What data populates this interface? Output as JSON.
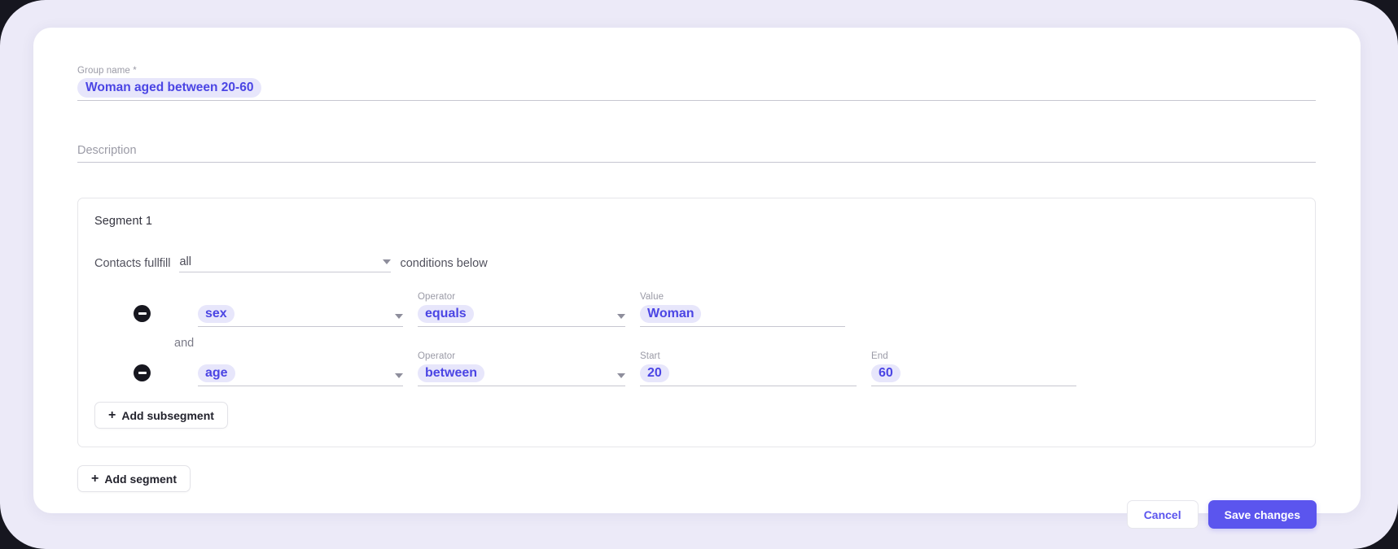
{
  "theme": {
    "accent": "#5b55ee",
    "accent_text": "#4b45e4",
    "highlight_bg": "#e7e6fb",
    "page_bg": "#eceaf8",
    "card_bg": "#ffffff",
    "outer_bg": "#16161f"
  },
  "group_name": {
    "label": "Group name *",
    "value": "Woman aged between 20-60"
  },
  "description": {
    "placeholder": "Description",
    "value": ""
  },
  "segment": {
    "title": "Segment 1",
    "fulfill_prefix": "Contacts fullfill",
    "fulfill_value": "all",
    "fulfill_suffix": "conditions below",
    "connector": "and",
    "conditions": [
      {
        "remove_icon": "minus-circle-icon",
        "attribute": {
          "label": "",
          "value": "sex"
        },
        "operator": {
          "label": "Operator",
          "value": "equals"
        },
        "fields": [
          {
            "label": "Value",
            "value": "Woman"
          }
        ]
      },
      {
        "remove_icon": "minus-circle-icon",
        "attribute": {
          "label": "",
          "value": "age"
        },
        "operator": {
          "label": "Operator",
          "value": "between"
        },
        "fields": [
          {
            "label": "Start",
            "value": "20"
          },
          {
            "label": "End",
            "value": "60"
          }
        ]
      }
    ],
    "add_subsegment_label": "Add subsegment",
    "add_icon": "plus-icon"
  },
  "add_segment_label": "Add segment",
  "footer": {
    "cancel_label": "Cancel",
    "save_label": "Save changes"
  }
}
